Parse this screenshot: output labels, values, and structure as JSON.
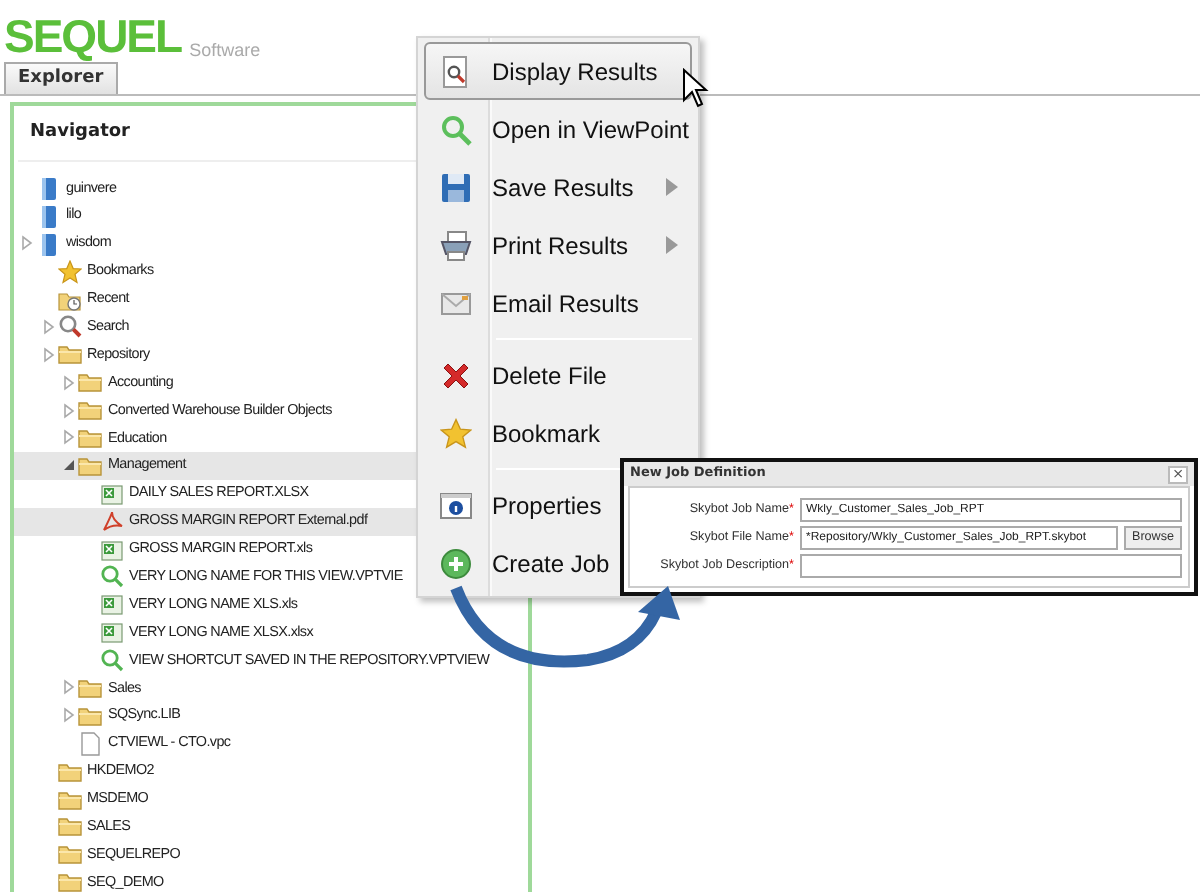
{
  "logo": {
    "name": "SEQUEL",
    "tagline": "Software"
  },
  "tabs": [
    {
      "label": "Explorer",
      "selected": true
    }
  ],
  "navigator": {
    "title": "Navigator",
    "tree": [
      {
        "label": "guinvere",
        "kind": "server",
        "selected": false
      },
      {
        "label": "lilo",
        "kind": "server",
        "selected": false
      },
      {
        "label": "wisdom",
        "kind": "server",
        "expanded": false,
        "selected": false,
        "children": [
          {
            "label": "Bookmarks",
            "kind": "bookmarks",
            "selected": false
          },
          {
            "label": "Recent",
            "kind": "recent",
            "selected": false
          },
          {
            "label": "Search",
            "kind": "search",
            "expanded": false,
            "selected": false
          },
          {
            "label": "Repository",
            "kind": "folder",
            "expanded": false,
            "selected": false,
            "children": [
              {
                "label": "Accounting",
                "kind": "folder",
                "expanded": false,
                "selected": false
              },
              {
                "label": "Converted Warehouse Builder Objects",
                "kind": "folder",
                "expanded": false,
                "selected": false
              },
              {
                "label": "Education",
                "kind": "folder",
                "expanded": false,
                "selected": false
              },
              {
                "label": "Management",
                "kind": "folder",
                "expanded": true,
                "selected": true,
                "children": [
                  {
                    "label": "DAILY SALES REPORT.XLSX",
                    "kind": "spreadsheet",
                    "selected": false
                  },
                  {
                    "label": "GROSS MARGIN REPORT External.pdf",
                    "kind": "pdf",
                    "selected": true
                  },
                  {
                    "label": "GROSS MARGIN REPORT.xls",
                    "kind": "spreadsheet",
                    "selected": false
                  },
                  {
                    "label": "VERY LONG NAME FOR THIS VIEW.VPTVIE",
                    "kind": "view",
                    "selected": false
                  },
                  {
                    "label": "VERY LONG NAME XLS.xls",
                    "kind": "spreadsheet",
                    "selected": false
                  },
                  {
                    "label": "VERY LONG NAME XLSX.xlsx",
                    "kind": "spreadsheet",
                    "selected": false
                  },
                  {
                    "label": "VIEW SHORTCUT SAVED IN THE REPOSITORY.VPTVIEW",
                    "kind": "view",
                    "selected": false
                  }
                ]
              },
              {
                "label": "Sales",
                "kind": "folder",
                "expanded": false,
                "selected": false
              },
              {
                "label": "SQSync.LIB",
                "kind": "folder",
                "expanded": false,
                "selected": false
              },
              {
                "label": "CTVIEWL - CTO.vpc",
                "kind": "file",
                "selected": false
              }
            ]
          },
          {
            "label": "HKDEMO2",
            "kind": "folder",
            "selected": false
          },
          {
            "label": "MSDEMO",
            "kind": "folder",
            "selected": false
          },
          {
            "label": "SALES",
            "kind": "folder",
            "selected": false
          },
          {
            "label": "SEQUELREPO",
            "kind": "folder",
            "selected": false
          },
          {
            "label": "SEQ_DEMO",
            "kind": "folder",
            "selected": false
          }
        ]
      }
    ]
  },
  "context_menu": {
    "groups": [
      [
        {
          "label": "Display Results",
          "selected": true,
          "submenu": false
        },
        {
          "label": "Open in ViewPoint",
          "selected": false,
          "submenu": false
        },
        {
          "label": "Save Results",
          "selected": false,
          "submenu": true
        },
        {
          "label": "Print Results",
          "selected": false,
          "submenu": true
        },
        {
          "label": "Email Results",
          "selected": false,
          "submenu": false
        }
      ],
      [
        {
          "label": "Delete File",
          "selected": false,
          "submenu": false
        },
        {
          "label": "Bookmark",
          "selected": false,
          "submenu": false
        }
      ],
      [
        {
          "label": "Properties",
          "selected": false,
          "submenu": false
        },
        {
          "label": "Create Job",
          "selected": false,
          "submenu": false
        }
      ]
    ]
  },
  "dialog": {
    "title": "New Job Definition",
    "close": "×",
    "fields": [
      {
        "label": "Skybot Job Name",
        "required_mark": "*",
        "value": "Wkly_Customer_Sales_Job_RPT"
      },
      {
        "label": "Skybot File Name",
        "required_mark": "*",
        "value": "*Repository/Wkly_Customer_Sales_Job_RPT.skybot",
        "button": "Browse"
      },
      {
        "label": "Skybot Job Description",
        "required_mark": "*"
      }
    ]
  }
}
